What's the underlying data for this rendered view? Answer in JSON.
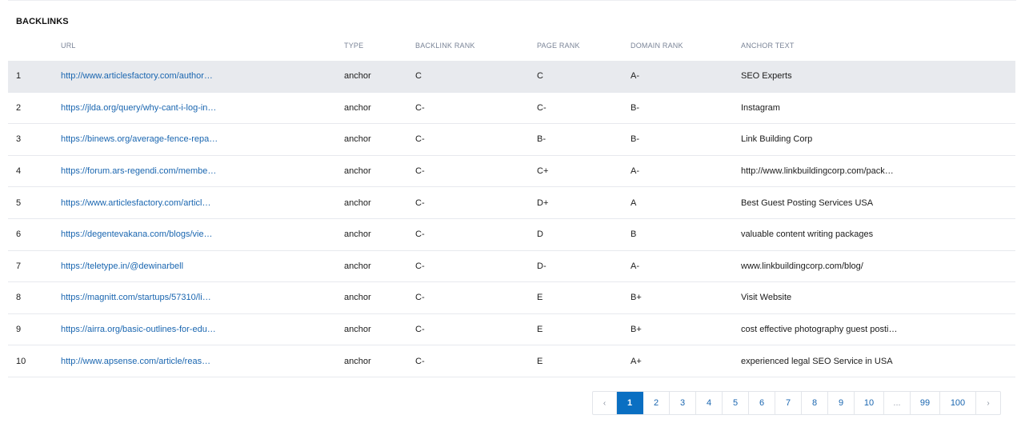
{
  "section": {
    "title": "BACKLINKS"
  },
  "table": {
    "headers": {
      "num": "",
      "url": "URL",
      "type": "TYPE",
      "backlink_rank": "BACKLINK RANK",
      "page_rank": "PAGE RANK",
      "domain_rank": "DOMAIN RANK",
      "anchor_text": "ANCHOR TEXT"
    },
    "rows": [
      {
        "num": "1",
        "url": "http://www.articlesfactory.com/author…",
        "type": "anchor",
        "backlink_rank": "C",
        "page_rank": "C",
        "domain_rank": "A-",
        "anchor_text": "SEO Experts"
      },
      {
        "num": "2",
        "url": "https://jlda.org/query/why-cant-i-log-in…",
        "type": "anchor",
        "backlink_rank": "C-",
        "page_rank": "C-",
        "domain_rank": "B-",
        "anchor_text": "Instagram"
      },
      {
        "num": "3",
        "url": "https://binews.org/average-fence-repa…",
        "type": "anchor",
        "backlink_rank": "C-",
        "page_rank": "B-",
        "domain_rank": "B-",
        "anchor_text": "Link Building Corp"
      },
      {
        "num": "4",
        "url": "https://forum.ars-regendi.com/membe…",
        "type": "anchor",
        "backlink_rank": "C-",
        "page_rank": "C+",
        "domain_rank": "A-",
        "anchor_text": "http://www.linkbuildingcorp.com/pack…"
      },
      {
        "num": "5",
        "url": "https://www.articlesfactory.com/articl…",
        "type": "anchor",
        "backlink_rank": "C-",
        "page_rank": "D+",
        "domain_rank": "A",
        "anchor_text": "Best Guest Posting Services USA"
      },
      {
        "num": "6",
        "url": "https://degentevakana.com/blogs/vie…",
        "type": "anchor",
        "backlink_rank": "C-",
        "page_rank": "D",
        "domain_rank": "B",
        "anchor_text": "valuable content writing packages"
      },
      {
        "num": "7",
        "url": "https://teletype.in/@dewinarbell",
        "type": "anchor",
        "backlink_rank": "C-",
        "page_rank": "D-",
        "domain_rank": "A-",
        "anchor_text": "www.linkbuildingcorp.com/blog/"
      },
      {
        "num": "8",
        "url": "https://magnitt.com/startups/57310/li…",
        "type": "anchor",
        "backlink_rank": "C-",
        "page_rank": "E",
        "domain_rank": "B+",
        "anchor_text": "Visit Website"
      },
      {
        "num": "9",
        "url": "https://airra.org/basic-outlines-for-edu…",
        "type": "anchor",
        "backlink_rank": "C-",
        "page_rank": "E",
        "domain_rank": "B+",
        "anchor_text": "cost effective photography guest posti…"
      },
      {
        "num": "10",
        "url": "http://www.apsense.com/article/reas…",
        "type": "anchor",
        "backlink_rank": "C-",
        "page_rank": "E",
        "domain_rank": "A+",
        "anchor_text": "experienced legal SEO Service in USA"
      }
    ],
    "selected_row": 1
  },
  "pagination": {
    "prev": "‹",
    "next": "›",
    "pages": [
      "1",
      "2",
      "3",
      "4",
      "5",
      "6",
      "7",
      "8",
      "9",
      "10",
      "...",
      "99",
      "100"
    ],
    "current": "1"
  },
  "colors": {
    "link": "#1a66b0",
    "active_page": "#0a6fc2",
    "selected_row_bg": "#e8eaee",
    "header_text": "#7a8497"
  }
}
